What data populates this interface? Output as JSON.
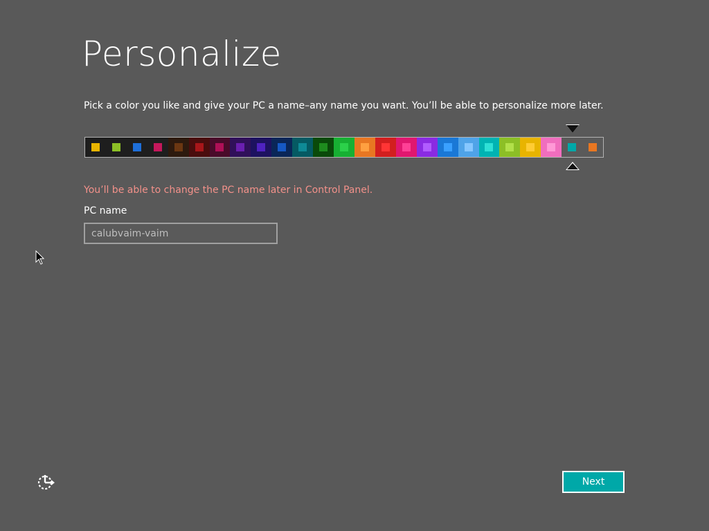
{
  "page": {
    "title": "Personalize"
  },
  "instruction": "Pick a color you like and give your PC a name–any name you want. You’ll be able to personalize more later.",
  "color_picker": {
    "selected_index": 23,
    "swatches": [
      {
        "background": "#1e1e1e",
        "chip": "#e8b400"
      },
      {
        "background": "#1e1e1e",
        "chip": "#8cbf26"
      },
      {
        "background": "#1e1e1e",
        "chip": "#1e6fd9"
      },
      {
        "background": "#1e1e1e",
        "chip": "#c4185b"
      },
      {
        "background": "#2d1a0e",
        "chip": "#6b3712"
      },
      {
        "background": "#4a0d0d",
        "chip": "#a8161a"
      },
      {
        "background": "#4a0b2a",
        "chip": "#b01057"
      },
      {
        "background": "#30105a",
        "chip": "#6a1fb0"
      },
      {
        "background": "#1d1260",
        "chip": "#4f22c0"
      },
      {
        "background": "#0a2658",
        "chip": "#1658c4"
      },
      {
        "background": "#055a63",
        "chip": "#0e8a96"
      },
      {
        "background": "#0a4a0a",
        "chip": "#1e8c1e"
      },
      {
        "background": "#17b033",
        "chip": "#2bd14a"
      },
      {
        "background": "#e87722",
        "chip": "#ffa040"
      },
      {
        "background": "#d21f1f",
        "chip": "#ff3535"
      },
      {
        "background": "#e0176f",
        "chip": "#ff4096"
      },
      {
        "background": "#8a2be2",
        "chip": "#b15cff"
      },
      {
        "background": "#1a78d6",
        "chip": "#3aa0ff"
      },
      {
        "background": "#4fa3e8",
        "chip": "#86c7ff"
      },
      {
        "background": "#00b3b3",
        "chip": "#2ee0d6"
      },
      {
        "background": "#8cbf26",
        "chip": "#b2e04a"
      },
      {
        "background": "#e8b400",
        "chip": "#ffcc33"
      },
      {
        "background": "#f06ebe",
        "chip": "#ff99d6"
      },
      {
        "background": "#5a5a5a",
        "chip": "#00a8a8"
      },
      {
        "background": "#5a5a5a",
        "chip": "#e87722"
      }
    ]
  },
  "pc_name": {
    "note": "You’ll be able to change the PC name later in Control Panel.",
    "label": "PC name",
    "value": "calubvaim-vaim"
  },
  "footer": {
    "accessibility_icon": "ease-of-access-icon",
    "next_label": "Next"
  },
  "colors": {
    "background": "#595959",
    "accent": "#00a8a8",
    "warning": "#f3918a"
  }
}
